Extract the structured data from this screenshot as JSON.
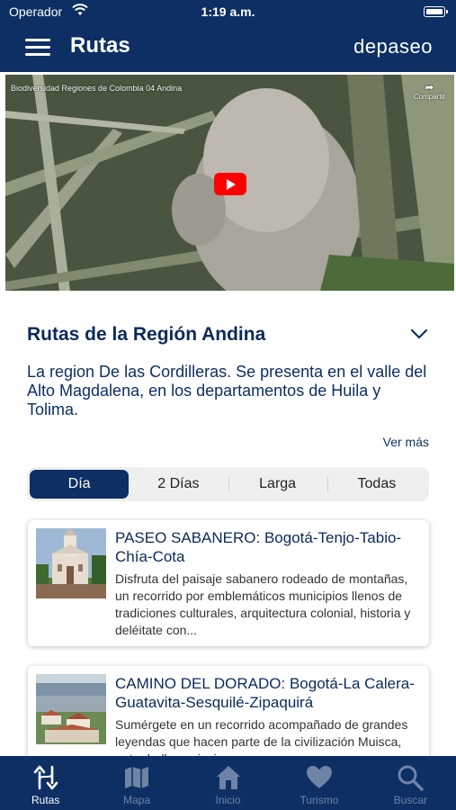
{
  "status": {
    "carrier": "Operador",
    "time": "1:19 a.m."
  },
  "header": {
    "title": "Rutas",
    "logo": "depaseo",
    "menu_icon": "hamburger-icon"
  },
  "video": {
    "title": "Biodiversidad Regiones de Colombia 04 Andina",
    "share_label": "Compartir",
    "play_icon": "youtube-play-icon"
  },
  "region": {
    "title": "Rutas de la Región Andina",
    "description": "La region De las Cordilleras. Se presenta en el valle del Alto Magdalena, en los departamentos de Huila y Tolima.",
    "more_label": "Ver más",
    "expand_icon": "chevron-down-icon"
  },
  "filters": {
    "selected": "Día",
    "options": [
      "Día",
      "2 Días",
      "Larga",
      "Todas"
    ]
  },
  "routes": [
    {
      "title": "PASEO SABANERO: Bogotá-Tenjo-Tabio-Chía-Cota",
      "description": "Disfruta del paisaje sabanero rodeado de montañas, un recorrido por emblemáticos municipios llenos de tradiciones culturales, arquitectura colonial, historia y deléitate con..."
    },
    {
      "title": "CAMINO DEL DORADO: Bogotá-La Calera-Guatavita-Sesquilé-Zipaquirá",
      "description": "Sumérgete en un recorrido acompañado de grandes leyendas que hacen parte de la civilización Muisca, entre bellos paisajes"
    }
  ],
  "tabs": [
    {
      "label": "Rutas",
      "icon": "routes-icon",
      "active": true
    },
    {
      "label": "Mapa",
      "icon": "map-icon",
      "active": false
    },
    {
      "label": "Inicio",
      "icon": "home-icon",
      "active": false
    },
    {
      "label": "Turismo",
      "icon": "heart-icon",
      "active": false
    },
    {
      "label": "Buscar",
      "icon": "search-icon",
      "active": false
    }
  ],
  "colors": {
    "primary": "#0d2f64",
    "inactive_tab": "#6f83a6",
    "play_red": "#ff0000"
  }
}
